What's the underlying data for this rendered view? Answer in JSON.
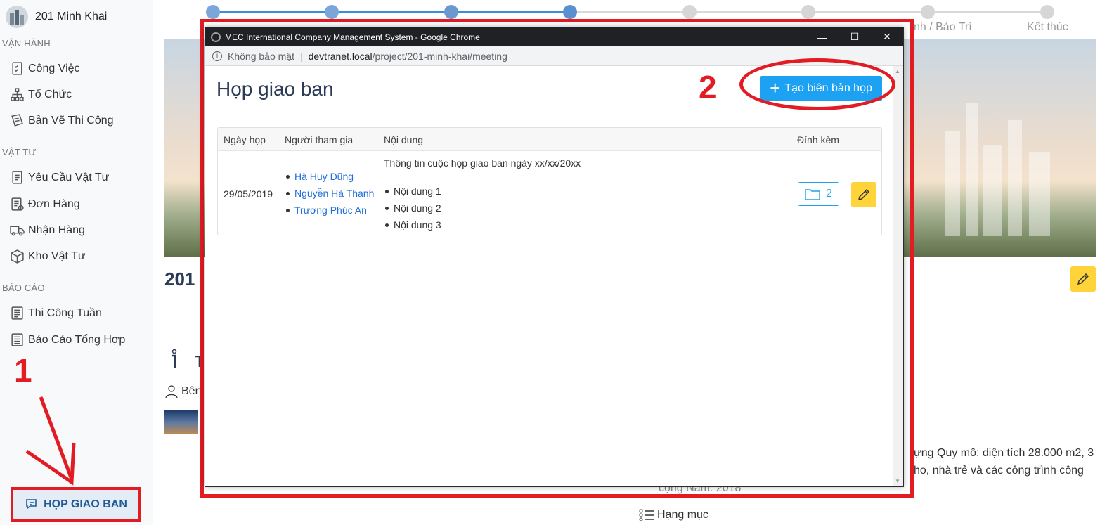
{
  "sidebar": {
    "project_name": "201 Minh Khai",
    "sections": [
      {
        "title": "VẬN HÀNH",
        "items": [
          {
            "label": "Công Việc",
            "icon": "checklist-icon"
          },
          {
            "label": "Tổ Chức",
            "icon": "org-chart-icon"
          },
          {
            "label": "Bản Vẽ Thi Công",
            "icon": "blueprint-icon"
          }
        ]
      },
      {
        "title": "VẬT TƯ",
        "items": [
          {
            "label": "Yêu Cầu Vật Tư",
            "icon": "document-icon"
          },
          {
            "label": "Đơn Hàng",
            "icon": "order-icon"
          },
          {
            "label": "Nhận Hàng",
            "icon": "truck-icon"
          },
          {
            "label": "Kho Vật Tư",
            "icon": "box-icon"
          }
        ]
      },
      {
        "title": "BÁO CÁO",
        "items": [
          {
            "label": "Thi Công Tuần",
            "icon": "report-icon"
          },
          {
            "label": "Báo Cáo Tổng Hợp",
            "icon": "summary-report-icon"
          }
        ]
      }
    ],
    "meeting_button": "HỌP GIAO BAN"
  },
  "stepper": {
    "labels": [
      "nh / Bảo Trì",
      "Kết thúc"
    ]
  },
  "background": {
    "project_title": "201",
    "side_text_1": "Bên",
    "side_text_2": "T",
    "description_1": "ựng Quy mô: diện tích 28.000 m2, 3",
    "description_2": "ho, nhà trẻ và các công trình công",
    "description_3": "cộng Năm: 2018",
    "category_label": "Hạng mục"
  },
  "annotations": {
    "step1": "1",
    "step2": "2"
  },
  "browser": {
    "window_title": "MEC International Company Management System - Google Chrome",
    "security_label": "Không bảo mật",
    "url_host": "devtranet.local",
    "url_path": "/project/201-minh-khai/meeting",
    "controls": {
      "minimize": "—",
      "maximize": "☐",
      "close": "✕"
    }
  },
  "meeting_page": {
    "title": "Họp giao ban",
    "create_button": "Tạo biên bản họp",
    "table": {
      "headers": [
        "Ngày họp",
        "Người tham gia",
        "Nội dung",
        "Đính kèm"
      ],
      "rows": [
        {
          "date": "29/05/2019",
          "participants": [
            "Hà Huy Dũng",
            "Nguyễn Hà Thanh",
            "Trương Phúc An"
          ],
          "content_title": "Thông tin cuộc họp giao ban ngày xx/xx/20xx",
          "content_items": [
            "Nội dung 1",
            "Nội dung 2",
            "Nội dung 3"
          ],
          "attachments": "2"
        }
      ]
    }
  },
  "colors": {
    "accent": "#1da1f2",
    "annotation_red": "#e31b23",
    "edit_yellow": "#ffd43b",
    "title_navy": "#2b3a55"
  }
}
